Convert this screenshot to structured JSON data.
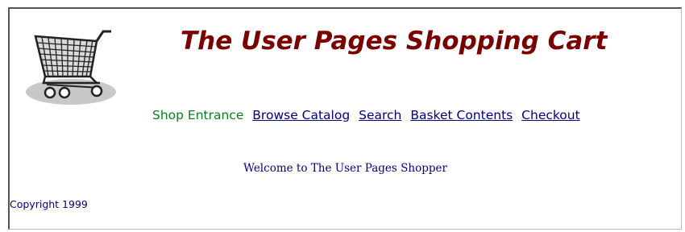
{
  "header": {
    "logo_icon": "shopping-cart-icon",
    "title": "The User Pages Shopping Cart"
  },
  "nav": {
    "current": "Shop Entrance",
    "links": [
      "Browse Catalog",
      "Search",
      "Basket Contents",
      "Checkout"
    ]
  },
  "main": {
    "welcome": "Welcome to The User Pages Shopper"
  },
  "footer": {
    "copyright": "Copyright 1999"
  },
  "colors": {
    "title": "#7a0000",
    "nav_current": "#0c7c1e",
    "link": "#000080",
    "text": "#000080"
  }
}
